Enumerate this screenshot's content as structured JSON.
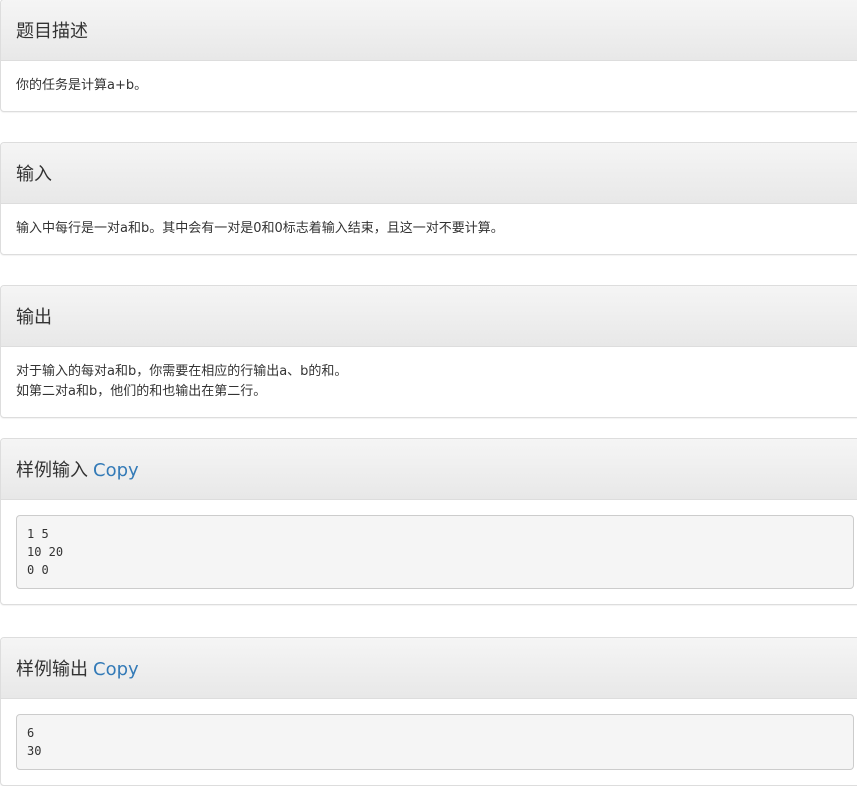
{
  "description": {
    "title": "题目描述",
    "text": "你的任务是计算a+b。"
  },
  "input": {
    "title": "输入",
    "text": "输入中每行是一对a和b。其中会有一对是0和0标志着输入结束，且这一对不要计算。"
  },
  "output": {
    "title": "输出",
    "lines": [
      "对于输入的每对a和b，你需要在相应的行输出a、b的和。",
      "如第二对a和b，他们的和也输出在第二行。"
    ]
  },
  "sample_input": {
    "title": "样例输入",
    "copy_label": "Copy",
    "content": "1 5\n10 20\n0 0"
  },
  "sample_output": {
    "title": "样例输出",
    "copy_label": "Copy",
    "content": "6\n30"
  },
  "colors": {
    "link": "#337ab7",
    "heading_bg": "#f5f5f5",
    "border": "#dddddd",
    "code_bg": "#f5f5f5"
  }
}
